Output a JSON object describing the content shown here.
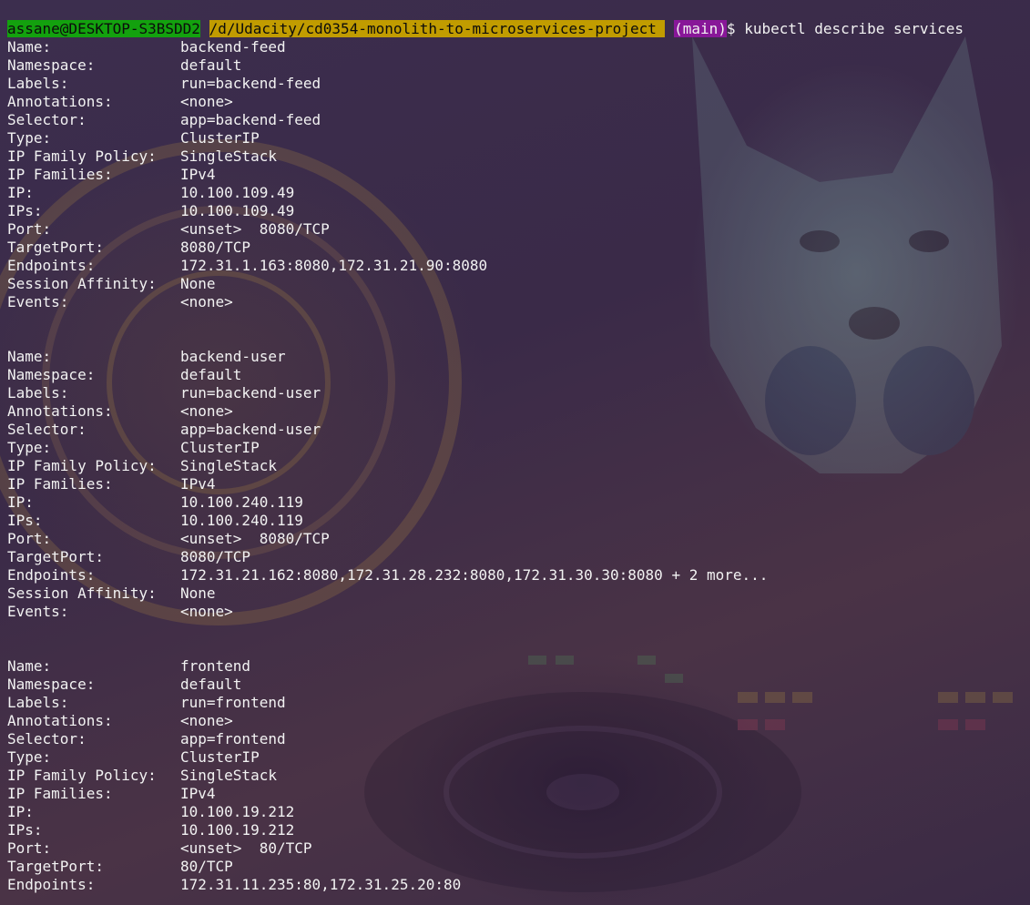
{
  "prompt": {
    "user_host": "assane@DESKTOP-S3BSDD2",
    "path": "/d/Udacity/cd0354-monolith-to-microservices-project",
    "branch": "(main)",
    "symbol": "$",
    "command": "kubectl describe services"
  },
  "services": [
    {
      "fields": [
        {
          "key": "Name:",
          "value": "backend-feed"
        },
        {
          "key": "Namespace:",
          "value": "default"
        },
        {
          "key": "Labels:",
          "value": "run=backend-feed"
        },
        {
          "key": "Annotations:",
          "value": "<none>"
        },
        {
          "key": "Selector:",
          "value": "app=backend-feed"
        },
        {
          "key": "Type:",
          "value": "ClusterIP"
        },
        {
          "key": "IP Family Policy:",
          "value": "SingleStack"
        },
        {
          "key": "IP Families:",
          "value": "IPv4"
        },
        {
          "key": "IP:",
          "value": "10.100.109.49"
        },
        {
          "key": "IPs:",
          "value": "10.100.109.49"
        },
        {
          "key": "Port:",
          "value": "<unset>  8080/TCP"
        },
        {
          "key": "TargetPort:",
          "value": "8080/TCP"
        },
        {
          "key": "Endpoints:",
          "value": "172.31.1.163:8080,172.31.21.90:8080"
        },
        {
          "key": "Session Affinity:",
          "value": "None"
        },
        {
          "key": "Events:",
          "value": "<none>"
        }
      ]
    },
    {
      "fields": [
        {
          "key": "Name:",
          "value": "backend-user"
        },
        {
          "key": "Namespace:",
          "value": "default"
        },
        {
          "key": "Labels:",
          "value": "run=backend-user"
        },
        {
          "key": "Annotations:",
          "value": "<none>"
        },
        {
          "key": "Selector:",
          "value": "app=backend-user"
        },
        {
          "key": "Type:",
          "value": "ClusterIP"
        },
        {
          "key": "IP Family Policy:",
          "value": "SingleStack"
        },
        {
          "key": "IP Families:",
          "value": "IPv4"
        },
        {
          "key": "IP:",
          "value": "10.100.240.119"
        },
        {
          "key": "IPs:",
          "value": "10.100.240.119"
        },
        {
          "key": "Port:",
          "value": "<unset>  8080/TCP"
        },
        {
          "key": "TargetPort:",
          "value": "8080/TCP"
        },
        {
          "key": "Endpoints:",
          "value": "172.31.21.162:8080,172.31.28.232:8080,172.31.30.30:8080 + 2 more..."
        },
        {
          "key": "Session Affinity:",
          "value": "None"
        },
        {
          "key": "Events:",
          "value": "<none>"
        }
      ]
    },
    {
      "fields": [
        {
          "key": "Name:",
          "value": "frontend"
        },
        {
          "key": "Namespace:",
          "value": "default"
        },
        {
          "key": "Labels:",
          "value": "run=frontend"
        },
        {
          "key": "Annotations:",
          "value": "<none>"
        },
        {
          "key": "Selector:",
          "value": "app=frontend"
        },
        {
          "key": "Type:",
          "value": "ClusterIP"
        },
        {
          "key": "IP Family Policy:",
          "value": "SingleStack"
        },
        {
          "key": "IP Families:",
          "value": "IPv4"
        },
        {
          "key": "IP:",
          "value": "10.100.19.212"
        },
        {
          "key": "IPs:",
          "value": "10.100.19.212"
        },
        {
          "key": "Port:",
          "value": "<unset>  80/TCP"
        },
        {
          "key": "TargetPort:",
          "value": "80/TCP"
        },
        {
          "key": "Endpoints:",
          "value": "172.31.11.235:80,172.31.25.20:80"
        }
      ]
    }
  ],
  "colors": {
    "user_bg": "#13a10e",
    "path_bg": "#c19c00",
    "branch_bg": "#881798",
    "text": "#f2f2f2"
  }
}
